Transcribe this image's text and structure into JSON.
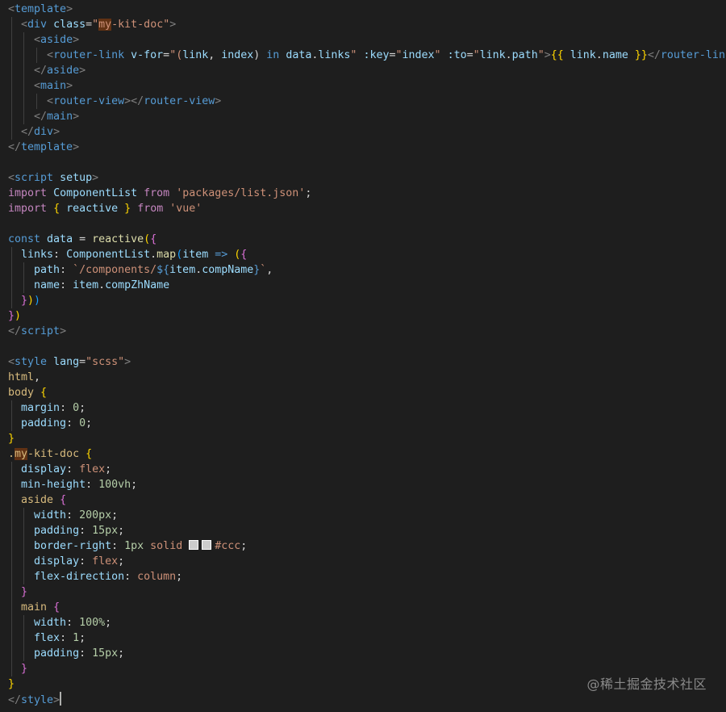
{
  "colors": {
    "background": "#1e1e1e",
    "tag": "#569cd6",
    "bracket": "#808080",
    "attr": "#9cdcfe",
    "string": "#ce9178",
    "keyword": "#c586c0",
    "storage": "#569cd6",
    "function": "#dcdcaa",
    "variable": "#9cdcfe",
    "class": "#4ec9b0",
    "text": "#d4d4d4",
    "number": "#b5cea8",
    "selector": "#d7ba7d",
    "brace_gold": "#ffd700",
    "brace_purple": "#da70d6",
    "brace_blue": "#179fff",
    "highlight": "#613214",
    "color_swatch": "#cccccc"
  },
  "editor": {
    "watermark": "@稀土掘金技术社区",
    "lines": [
      [
        [
          "<",
          "bracket"
        ],
        [
          "template",
          "tag"
        ],
        [
          ">",
          "bracket"
        ]
      ],
      [
        [
          "  "
        ],
        [
          "<",
          "bracket"
        ],
        [
          "div",
          "tag"
        ],
        [
          " "
        ],
        [
          "class",
          "attr"
        ],
        [
          "=",
          "text"
        ],
        [
          "\"",
          "string"
        ],
        [
          "my",
          "string",
          "hl"
        ],
        [
          "-kit-doc\"",
          "string"
        ],
        [
          ">",
          "bracket"
        ]
      ],
      [
        [
          "    "
        ],
        [
          "<",
          "bracket"
        ],
        [
          "aside",
          "tag"
        ],
        [
          ">",
          "bracket"
        ]
      ],
      [
        [
          "      "
        ],
        [
          "<",
          "bracket"
        ],
        [
          "router-link",
          "tag"
        ],
        [
          " "
        ],
        [
          "v-for",
          "attr"
        ],
        [
          "=",
          "text"
        ],
        [
          "\"(",
          "string"
        ],
        [
          "link",
          "variable"
        ],
        [
          ", ",
          "text"
        ],
        [
          "index",
          "variable"
        ],
        [
          ") ",
          "text"
        ],
        [
          "in",
          "storage"
        ],
        [
          " "
        ],
        [
          "data",
          "variable"
        ],
        [
          ".",
          "text"
        ],
        [
          "links",
          "variable"
        ],
        [
          "\"",
          "string"
        ],
        [
          " "
        ],
        [
          ":key",
          "attr"
        ],
        [
          "=",
          "text"
        ],
        [
          "\"",
          "string"
        ],
        [
          "index",
          "variable"
        ],
        [
          "\"",
          "string"
        ],
        [
          " "
        ],
        [
          ":to",
          "attr"
        ],
        [
          "=",
          "text"
        ],
        [
          "\"",
          "string"
        ],
        [
          "link",
          "variable"
        ],
        [
          ".",
          "text"
        ],
        [
          "path",
          "variable"
        ],
        [
          "\"",
          "string"
        ],
        [
          ">",
          "bracket"
        ],
        [
          "{{",
          "brace_gold"
        ],
        [
          " "
        ],
        [
          "link",
          "variable"
        ],
        [
          ".",
          "text"
        ],
        [
          "name",
          "variable"
        ],
        [
          " "
        ],
        [
          "}}",
          "brace_gold"
        ],
        [
          "</",
          "bracket"
        ],
        [
          "router-link",
          "tag"
        ],
        [
          ">",
          "bracket"
        ]
      ],
      [
        [
          "    "
        ],
        [
          "</",
          "bracket"
        ],
        [
          "aside",
          "tag"
        ],
        [
          ">",
          "bracket"
        ]
      ],
      [
        [
          "    "
        ],
        [
          "<",
          "bracket"
        ],
        [
          "main",
          "tag"
        ],
        [
          ">",
          "bracket"
        ]
      ],
      [
        [
          "      "
        ],
        [
          "<",
          "bracket"
        ],
        [
          "router-view",
          "tag"
        ],
        [
          "></",
          "bracket"
        ],
        [
          "router-view",
          "tag"
        ],
        [
          ">",
          "bracket"
        ]
      ],
      [
        [
          "    "
        ],
        [
          "</",
          "bracket"
        ],
        [
          "main",
          "tag"
        ],
        [
          ">",
          "bracket"
        ]
      ],
      [
        [
          "  "
        ],
        [
          "</",
          "bracket"
        ],
        [
          "div",
          "tag"
        ],
        [
          ">",
          "bracket"
        ]
      ],
      [
        [
          "</",
          "bracket"
        ],
        [
          "template",
          "tag"
        ],
        [
          ">",
          "bracket"
        ]
      ],
      [],
      [
        [
          "<",
          "bracket"
        ],
        [
          "script",
          "tag"
        ],
        [
          " "
        ],
        [
          "setup",
          "attr"
        ],
        [
          ">",
          "bracket"
        ]
      ],
      [
        [
          "import",
          "keyword"
        ],
        [
          " "
        ],
        [
          "ComponentList",
          "variable"
        ],
        [
          " "
        ],
        [
          "from",
          "keyword"
        ],
        [
          " "
        ],
        [
          "'packages/list.json'",
          "string"
        ],
        [
          ";",
          "text"
        ]
      ],
      [
        [
          "import",
          "keyword"
        ],
        [
          " "
        ],
        [
          "{",
          "brace_gold"
        ],
        [
          " "
        ],
        [
          "reactive",
          "variable"
        ],
        [
          " "
        ],
        [
          "}",
          "brace_gold"
        ],
        [
          " "
        ],
        [
          "from",
          "keyword"
        ],
        [
          " "
        ],
        [
          "'vue'",
          "string"
        ]
      ],
      [],
      [
        [
          "const",
          "storage"
        ],
        [
          " "
        ],
        [
          "data",
          "variable"
        ],
        [
          " "
        ],
        [
          "=",
          "text"
        ],
        [
          " "
        ],
        [
          "reactive",
          "function"
        ],
        [
          "(",
          "brace_gold"
        ],
        [
          "{",
          "brace_purple"
        ]
      ],
      [
        [
          "  "
        ],
        [
          "links",
          "variable"
        ],
        [
          ": ",
          "text"
        ],
        [
          "ComponentList",
          "variable"
        ],
        [
          ".",
          "text"
        ],
        [
          "map",
          "function"
        ],
        [
          "(",
          "brace_blue"
        ],
        [
          "item",
          "variable"
        ],
        [
          " "
        ],
        [
          "=>",
          "storage"
        ],
        [
          " "
        ],
        [
          "(",
          "brace_gold"
        ],
        [
          "{",
          "brace_purple"
        ]
      ],
      [
        [
          "    "
        ],
        [
          "path",
          "variable"
        ],
        [
          ": ",
          "text"
        ],
        [
          "`/components/",
          "string"
        ],
        [
          "${",
          "storage"
        ],
        [
          "item",
          "variable"
        ],
        [
          ".",
          "text"
        ],
        [
          "compName",
          "variable"
        ],
        [
          "}",
          "storage"
        ],
        [
          "`",
          "string"
        ],
        [
          ",",
          "text"
        ]
      ],
      [
        [
          "    "
        ],
        [
          "name",
          "variable"
        ],
        [
          ": ",
          "text"
        ],
        [
          "item",
          "variable"
        ],
        [
          ".",
          "text"
        ],
        [
          "compZhName",
          "variable"
        ]
      ],
      [
        [
          "  "
        ],
        [
          "}",
          "brace_purple"
        ],
        [
          ")",
          "brace_gold"
        ],
        [
          ")",
          "brace_blue"
        ]
      ],
      [
        [
          "}",
          "brace_purple"
        ],
        [
          ")",
          "brace_gold"
        ]
      ],
      [
        [
          "</",
          "bracket"
        ],
        [
          "script",
          "tag"
        ],
        [
          ">",
          "bracket"
        ]
      ],
      [],
      [
        [
          "<",
          "bracket"
        ],
        [
          "style",
          "tag"
        ],
        [
          " "
        ],
        [
          "lang",
          "attr"
        ],
        [
          "=",
          "text"
        ],
        [
          "\"scss\"",
          "string"
        ],
        [
          ">",
          "bracket"
        ]
      ],
      [
        [
          "html",
          "selector"
        ],
        [
          ",",
          "text"
        ]
      ],
      [
        [
          "body",
          "selector"
        ],
        [
          " "
        ],
        [
          "{",
          "brace_gold"
        ]
      ],
      [
        [
          "  "
        ],
        [
          "margin",
          "variable"
        ],
        [
          ": ",
          "text"
        ],
        [
          "0",
          "number"
        ],
        [
          ";",
          "text"
        ]
      ],
      [
        [
          "  "
        ],
        [
          "padding",
          "variable"
        ],
        [
          ": ",
          "text"
        ],
        [
          "0",
          "number"
        ],
        [
          ";",
          "text"
        ]
      ],
      [
        [
          "}",
          "brace_gold"
        ]
      ],
      [
        [
          ".",
          "selector"
        ],
        [
          "my",
          "selector",
          "hl"
        ],
        [
          "-kit-doc",
          "selector"
        ],
        [
          " "
        ],
        [
          "{",
          "brace_gold"
        ]
      ],
      [
        [
          "  "
        ],
        [
          "display",
          "variable"
        ],
        [
          ": ",
          "text"
        ],
        [
          "flex",
          "string"
        ],
        [
          ";",
          "text"
        ]
      ],
      [
        [
          "  "
        ],
        [
          "min-height",
          "variable"
        ],
        [
          ": ",
          "text"
        ],
        [
          "100vh",
          "number"
        ],
        [
          ";",
          "text"
        ]
      ],
      [
        [
          "  "
        ],
        [
          "aside",
          "selector"
        ],
        [
          " "
        ],
        [
          "{",
          "brace_purple"
        ]
      ],
      [
        [
          "    "
        ],
        [
          "width",
          "variable"
        ],
        [
          ": ",
          "text"
        ],
        [
          "200px",
          "number"
        ],
        [
          ";",
          "text"
        ]
      ],
      [
        [
          "    "
        ],
        [
          "padding",
          "variable"
        ],
        [
          ": ",
          "text"
        ],
        [
          "15px",
          "number"
        ],
        [
          ";",
          "text"
        ]
      ],
      [
        [
          "    "
        ],
        [
          "border-right",
          "variable"
        ],
        [
          ": ",
          "text"
        ],
        [
          "1px",
          "number"
        ],
        [
          " "
        ],
        [
          "solid",
          "string"
        ],
        [
          " "
        ],
        [
          "",
          "swatch"
        ],
        [
          "",
          "swatch"
        ],
        [
          "#ccc",
          "string"
        ],
        [
          ";",
          "text"
        ]
      ],
      [
        [
          "    "
        ],
        [
          "display",
          "variable"
        ],
        [
          ": ",
          "text"
        ],
        [
          "flex",
          "string"
        ],
        [
          ";",
          "text"
        ]
      ],
      [
        [
          "    "
        ],
        [
          "flex-direction",
          "variable"
        ],
        [
          ": ",
          "text"
        ],
        [
          "column",
          "string"
        ],
        [
          ";",
          "text"
        ]
      ],
      [
        [
          "  "
        ],
        [
          "}",
          "brace_purple"
        ]
      ],
      [
        [
          "  "
        ],
        [
          "main",
          "selector"
        ],
        [
          " "
        ],
        [
          "{",
          "brace_purple"
        ]
      ],
      [
        [
          "    "
        ],
        [
          "width",
          "variable"
        ],
        [
          ": ",
          "text"
        ],
        [
          "100%",
          "number"
        ],
        [
          ";",
          "text"
        ]
      ],
      [
        [
          "    "
        ],
        [
          "flex",
          "variable"
        ],
        [
          ": ",
          "text"
        ],
        [
          "1",
          "number"
        ],
        [
          ";",
          "text"
        ]
      ],
      [
        [
          "    "
        ],
        [
          "padding",
          "variable"
        ],
        [
          ": ",
          "text"
        ],
        [
          "15px",
          "number"
        ],
        [
          ";",
          "text"
        ]
      ],
      [
        [
          "  "
        ],
        [
          "}",
          "brace_purple"
        ]
      ],
      [
        [
          "}",
          "brace_gold"
        ]
      ],
      [
        [
          "</",
          "bracket"
        ],
        [
          "style",
          "tag"
        ],
        [
          ">",
          "bracket"
        ],
        [
          "",
          "cursor"
        ]
      ]
    ]
  }
}
